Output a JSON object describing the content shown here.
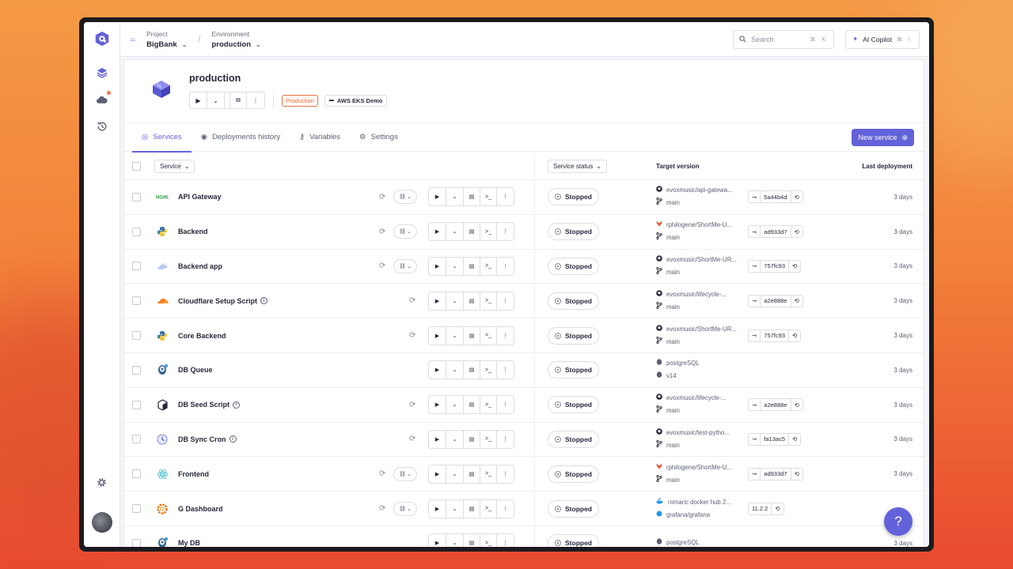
{
  "topbar": {
    "project_label": "Project",
    "project_value": "BigBank",
    "environment_label": "Environment",
    "environment_value": "production",
    "search_placeholder": "Search",
    "search_shortcut": "⌘ K",
    "copilot_label": "AI Copilot",
    "copilot_shortcut": "⌘ I"
  },
  "header": {
    "title": "production",
    "tag_type": "Production",
    "tag_cluster": "AWS EKS Demo"
  },
  "tabs": [
    {
      "label": "Services",
      "icon": "services-icon"
    },
    {
      "label": "Deployments history",
      "icon": "history-icon"
    },
    {
      "label": "Variables",
      "icon": "key-icon"
    },
    {
      "label": "Settings",
      "icon": "gear-icon"
    }
  ],
  "new_service_label": "New service",
  "table": {
    "col_service": "Service",
    "col_status": "Service status",
    "col_target": "Target version",
    "col_last": "Last deployment"
  },
  "rows": [
    {
      "name": "API Gateway",
      "icon": "nginx-icon",
      "info": false,
      "link": true,
      "status": "Stopped",
      "repo": "evoxmusic/api-gatewa...",
      "branch": "main",
      "repo_icon": "github-icon",
      "commit": "5a44b4d",
      "last": "3 days"
    },
    {
      "name": "Backend",
      "icon": "python-icon",
      "info": false,
      "link": true,
      "status": "Stopped",
      "repo": "rphilogene/ShortMe-U...",
      "branch": "main",
      "repo_icon": "gitlab-icon",
      "commit": "ad933d7",
      "last": "3 days"
    },
    {
      "name": "Backend app",
      "icon": "app-icon",
      "info": false,
      "link": true,
      "status": "Stopped",
      "repo": "evoxmusic/ShortMe-UR...",
      "branch": "main",
      "repo_icon": "github-icon",
      "commit": "757fc93",
      "last": "3 days"
    },
    {
      "name": "Cloudflare Setup Script",
      "icon": "cloudflare-icon",
      "info": true,
      "link": false,
      "status": "Stopped",
      "repo": "evoxmusic/lifecycle-...",
      "branch": "main",
      "repo_icon": "github-icon",
      "commit": "a2e888e",
      "last": "3 days"
    },
    {
      "name": "Core Backend",
      "icon": "python-icon",
      "info": false,
      "link": false,
      "status": "Stopped",
      "repo": "evoxmusic/ShortMe-UR...",
      "branch": "main",
      "repo_icon": "github-icon",
      "commit": "757fc93",
      "last": "3 days"
    },
    {
      "name": "DB Queue",
      "icon": "postgres-icon",
      "info": false,
      "link": false,
      "nosync": true,
      "status": "Stopped",
      "repo": "postgreSQL",
      "branch": "v14",
      "repo_icon": "postgres-small-icon",
      "commit": "",
      "last": "3 days"
    },
    {
      "name": "DB Seed Script",
      "icon": "script-icon",
      "info": true,
      "link": false,
      "status": "Stopped",
      "repo": "evoxmusic/lifecycle-...",
      "branch": "main",
      "repo_icon": "github-icon",
      "commit": "a2e888e",
      "last": "3 days"
    },
    {
      "name": "DB Sync Cron",
      "icon": "clock-icon",
      "info": true,
      "link": false,
      "status": "Stopped",
      "repo": "evoxmusic/test-pytho...",
      "branch": "main",
      "repo_icon": "github-icon",
      "commit": "fa13ac5",
      "last": "3 days"
    },
    {
      "name": "Frontend",
      "icon": "react-icon",
      "info": false,
      "link": true,
      "status": "Stopped",
      "repo": "rphilogene/ShortMe-U...",
      "branch": "main",
      "repo_icon": "gitlab-icon",
      "commit": "ad933d7",
      "last": "3 days"
    },
    {
      "name": "G Dashboard",
      "icon": "grafana-icon",
      "info": false,
      "link": true,
      "status": "Stopped",
      "repo": "romaric docker hub 2...",
      "branch": "grafana/grafana",
      "repo_icon": "docker-icon",
      "commit": "11.2.2",
      "last": ""
    },
    {
      "name": "My DB",
      "icon": "postgres-icon",
      "info": false,
      "link": false,
      "nosync": true,
      "status": "Stopped",
      "repo": "postgreSQL",
      "branch": "",
      "repo_icon": "postgres-small-icon",
      "commit": "",
      "last": "3 days"
    }
  ],
  "colors": {
    "accent": "#6462d9",
    "tag_orange": "#e0764a"
  }
}
